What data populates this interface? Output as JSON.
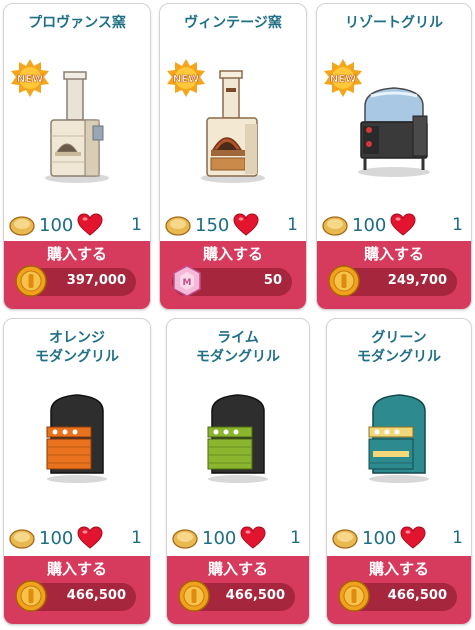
{
  "buy_label": "購入する",
  "new_label": "NEW",
  "cards": [
    {
      "name": "プロヴァンス窯",
      "is_new": true,
      "bread_cost": "100",
      "hearts": "1",
      "currency_icon": "coin-icon",
      "price": "397,000"
    },
    {
      "name": "ヴィンテージ窯",
      "is_new": true,
      "bread_cost": "150",
      "hearts": "1",
      "currency_icon": "gem-icon",
      "price": "50"
    },
    {
      "name": "リゾートグリル",
      "is_new": true,
      "bread_cost": "100",
      "hearts": "1",
      "currency_icon": "coin-icon",
      "price": "249,700"
    },
    {
      "name": "オレンジ\nモダングリル",
      "is_new": false,
      "bread_cost": "100",
      "hearts": "1",
      "currency_icon": "coin-icon",
      "price": "466,500"
    },
    {
      "name": "ライム\nモダングリル",
      "is_new": false,
      "bread_cost": "100",
      "hearts": "1",
      "currency_icon": "coin-icon",
      "price": "466,500"
    },
    {
      "name": "グリーン\nモダングリル",
      "is_new": false,
      "bread_cost": "100",
      "hearts": "1",
      "currency_icon": "coin-icon",
      "price": "466,500"
    }
  ],
  "colors": {
    "title": "#1f6f86",
    "buy_bar": "#d63b5e",
    "price_pill": "#a6263e",
    "orange_grill": "#e8721e",
    "lime_grill": "#8bb52e",
    "green_grill": "#2d8a8e"
  }
}
